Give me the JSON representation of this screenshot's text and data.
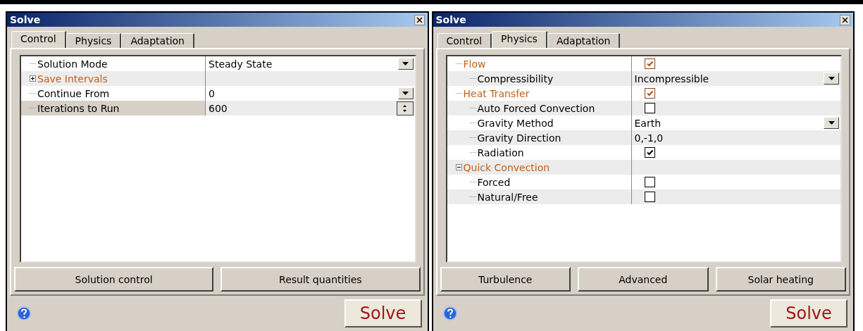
{
  "panels": [
    {
      "title": "Solve",
      "tabs": [
        {
          "label": "Control",
          "selected": true
        },
        {
          "label": "Physics",
          "selected": false
        },
        {
          "label": "Adaptation",
          "selected": false
        }
      ],
      "rows": [
        {
          "kind": "dropdown",
          "heading": false,
          "label": "Solution Mode",
          "value": "Steady State",
          "selected": false
        },
        {
          "heading": true,
          "label": "Save Intervals",
          "expanded": false,
          "selected": false
        },
        {
          "kind": "dropdown",
          "heading": false,
          "label": "Continue From",
          "value": "0",
          "selected": false
        },
        {
          "kind": "spinner",
          "heading": false,
          "label": "Iterations to Run",
          "value": "600",
          "selected": true
        }
      ],
      "buttons": [
        "Solution control",
        "Result quantities"
      ],
      "action": "Solve"
    },
    {
      "title": "Solve",
      "tabs": [
        {
          "label": "Control",
          "selected": false
        },
        {
          "label": "Physics",
          "selected": true
        },
        {
          "label": "Adaptation",
          "selected": false
        }
      ],
      "rows": [
        {
          "kind": "checkbox",
          "heading": true,
          "label": "Flow",
          "checked": true,
          "selected": false,
          "children": [
            {
              "kind": "dropdown",
              "heading": false,
              "label": "Compressibility",
              "value": "Incompressible",
              "selected": false
            }
          ]
        },
        {
          "kind": "checkbox",
          "heading": true,
          "label": "Heat Transfer",
          "checked": true,
          "selected": false,
          "children": [
            {
              "kind": "checkbox",
              "heading": false,
              "label": "Auto Forced Convection",
              "checked": false,
              "selected": false
            },
            {
              "kind": "dropdown",
              "heading": false,
              "label": "Gravity Method",
              "value": "Earth",
              "selected": false
            },
            {
              "kind": "text",
              "heading": false,
              "label": "Gravity Direction",
              "value": "0,-1,0",
              "selected": false
            },
            {
              "kind": "checkbox",
              "heading": false,
              "label": "Radiation",
              "checked": true,
              "selected": false
            }
          ]
        },
        {
          "heading": true,
          "label": "Quick Convection",
          "expanded": true,
          "selected": false,
          "children": [
            {
              "kind": "checkbox",
              "heading": false,
              "label": "Forced",
              "checked": false,
              "selected": false
            },
            {
              "kind": "checkbox",
              "heading": false,
              "label": "Natural/Free",
              "checked": false,
              "selected": false
            }
          ]
        }
      ],
      "buttons": [
        "Turbulence",
        "Advanced",
        "Solar heating"
      ],
      "action": "Solve"
    }
  ]
}
